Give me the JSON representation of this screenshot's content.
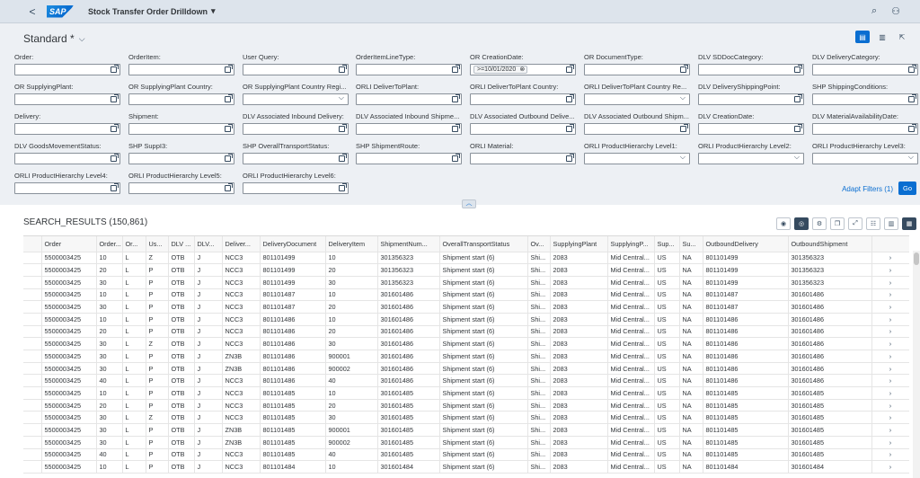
{
  "shell": {
    "back": "<",
    "logo": "SAP",
    "title": "Stock Transfer Order Drilldown",
    "title_caret": "▾"
  },
  "variant": {
    "name": "Standard *",
    "chev": "⌵"
  },
  "filters": [
    {
      "label": "Order:",
      "kind": "vh"
    },
    {
      "label": "OrderItem:",
      "kind": "vh"
    },
    {
      "label": "User Query:",
      "kind": "vh"
    },
    {
      "label": "OrderItemLineType:",
      "kind": "vh"
    },
    {
      "label": "OR CreationDate:",
      "kind": "vh",
      "token": ">=10/01/2020"
    },
    {
      "label": "OR DocumentType:",
      "kind": "vh"
    },
    {
      "label": "DLV SDDocCategory:",
      "kind": "vh"
    },
    {
      "label": "DLV DeliveryCategory:",
      "kind": "vh"
    },
    {
      "label": "OR SupplyingPlant:",
      "kind": "vh"
    },
    {
      "label": "OR SupplyingPlant Country:",
      "kind": "vh"
    },
    {
      "label": "OR SupplyingPlant Country Regi...",
      "kind": "dd"
    },
    {
      "label": "ORLI DeliverToPlant:",
      "kind": "vh"
    },
    {
      "label": "ORLI DeliverToPlant Country:",
      "kind": "vh"
    },
    {
      "label": "ORLI DeliverToPlant Country Re...",
      "kind": "dd"
    },
    {
      "label": "DLV DeliveryShippingPoint:",
      "kind": "vh"
    },
    {
      "label": "SHP ShippingConditions:",
      "kind": "vh"
    },
    {
      "label": "Delivery:",
      "kind": "vh"
    },
    {
      "label": "Shipment:",
      "kind": "vh"
    },
    {
      "label": "DLV Associated Inbound Delivery:",
      "kind": "vh"
    },
    {
      "label": "DLV Associated Inbound Shipme...",
      "kind": "vh"
    },
    {
      "label": "DLV Associated Outbound Delive...",
      "kind": "vh"
    },
    {
      "label": "DLV Associated Outbound Shipm...",
      "kind": "vh"
    },
    {
      "label": "DLV CreationDate:",
      "kind": "vh"
    },
    {
      "label": "DLV MaterialAvailabilityDate:",
      "kind": "vh"
    },
    {
      "label": "DLV GoodsMovementStatus:",
      "kind": "vh"
    },
    {
      "label": "SHP SuppI3:",
      "kind": "vh"
    },
    {
      "label": "SHP OverallTransportStatus:",
      "kind": "vh"
    },
    {
      "label": "SHP ShipmentRoute:",
      "kind": "vh"
    },
    {
      "label": "ORLI Material:",
      "kind": "vh"
    },
    {
      "label": "ORLI ProductHierarchy Level1:",
      "kind": "dd"
    },
    {
      "label": "ORLI ProductHierarchy Level2:",
      "kind": "dd"
    },
    {
      "label": "ORLI ProductHierarchy Level3:",
      "kind": "dd"
    },
    {
      "label": "ORLI ProductHierarchy Level4:",
      "kind": "vh"
    },
    {
      "label": "ORLI ProductHierarchy Level5:",
      "kind": "vh"
    },
    {
      "label": "ORLI ProductHierarchy Level6:",
      "kind": "vh"
    }
  ],
  "filterbar": {
    "adapt": "Adapt Filters (1)",
    "go": "Go",
    "collapse": "︿"
  },
  "results": {
    "title": "SEARCH_RESULTS (150,861)",
    "columns": [
      "Order",
      "Order...",
      "Or...",
      "Us...",
      "DLV ...",
      "DLV...",
      "Deliver...",
      "DeliveryDocument",
      "DeliveryItem",
      "ShipmentNum...",
      "OverallTransportStatus",
      "Ov...",
      "SupplyingPlant",
      "SupplyingP...",
      "Sup...",
      "Su...",
      "OutboundDelivery",
      "OutboundShipment"
    ],
    "rows": [
      [
        "5500003425",
        "10",
        "L",
        "Z",
        "OTB",
        "J",
        "NCC3",
        "801101499",
        "10",
        "301356323",
        "Shipment start (6)",
        "Shi...",
        "2083",
        "Mid Central...",
        "US",
        "NA",
        "801101499",
        "301356323"
      ],
      [
        "5500003425",
        "20",
        "L",
        "P",
        "OTB",
        "J",
        "NCC3",
        "801101499",
        "20",
        "301356323",
        "Shipment start (6)",
        "Shi...",
        "2083",
        "Mid Central...",
        "US",
        "NA",
        "801101499",
        "301356323"
      ],
      [
        "5500003425",
        "30",
        "L",
        "P",
        "OTB",
        "J",
        "NCC3",
        "801101499",
        "30",
        "301356323",
        "Shipment start (6)",
        "Shi...",
        "2083",
        "Mid Central...",
        "US",
        "NA",
        "801101499",
        "301356323"
      ],
      [
        "5500003425",
        "10",
        "L",
        "P",
        "OTB",
        "J",
        "NCC3",
        "801101487",
        "10",
        "301601486",
        "Shipment start (6)",
        "Shi...",
        "2083",
        "Mid Central...",
        "US",
        "NA",
        "801101487",
        "301601486"
      ],
      [
        "5500003425",
        "30",
        "L",
        "P",
        "OTB",
        "J",
        "NCC3",
        "801101487",
        "20",
        "301601486",
        "Shipment start (6)",
        "Shi...",
        "2083",
        "Mid Central...",
        "US",
        "NA",
        "801101487",
        "301601486"
      ],
      [
        "5500003425",
        "10",
        "L",
        "P",
        "OTB",
        "J",
        "NCC3",
        "801101486",
        "10",
        "301601486",
        "Shipment start (6)",
        "Shi...",
        "2083",
        "Mid Central...",
        "US",
        "NA",
        "801101486",
        "301601486"
      ],
      [
        "5500003425",
        "20",
        "L",
        "P",
        "OTB",
        "J",
        "NCC3",
        "801101486",
        "20",
        "301601486",
        "Shipment start (6)",
        "Shi...",
        "2083",
        "Mid Central...",
        "US",
        "NA",
        "801101486",
        "301601486"
      ],
      [
        "5500003425",
        "30",
        "L",
        "Z",
        "OTB",
        "J",
        "NCC3",
        "801101486",
        "30",
        "301601486",
        "Shipment start (6)",
        "Shi...",
        "2083",
        "Mid Central...",
        "US",
        "NA",
        "801101486",
        "301601486"
      ],
      [
        "5500003425",
        "30",
        "L",
        "P",
        "OTB",
        "J",
        "ZN3B",
        "801101486",
        "900001",
        "301601486",
        "Shipment start (6)",
        "Shi...",
        "2083",
        "Mid Central...",
        "US",
        "NA",
        "801101486",
        "301601486"
      ],
      [
        "5500003425",
        "30",
        "L",
        "P",
        "OTB",
        "J",
        "ZN3B",
        "801101486",
        "900002",
        "301601486",
        "Shipment start (6)",
        "Shi...",
        "2083",
        "Mid Central...",
        "US",
        "NA",
        "801101486",
        "301601486"
      ],
      [
        "5500003425",
        "40",
        "L",
        "P",
        "OTB",
        "J",
        "NCC3",
        "801101486",
        "40",
        "301601486",
        "Shipment start (6)",
        "Shi...",
        "2083",
        "Mid Central...",
        "US",
        "NA",
        "801101486",
        "301601486"
      ],
      [
        "5500003425",
        "10",
        "L",
        "P",
        "OTB",
        "J",
        "NCC3",
        "801101485",
        "10",
        "301601485",
        "Shipment start (6)",
        "Shi...",
        "2083",
        "Mid Central...",
        "US",
        "NA",
        "801101485",
        "301601485"
      ],
      [
        "5500003425",
        "20",
        "L",
        "P",
        "OTB",
        "J",
        "NCC3",
        "801101485",
        "20",
        "301601485",
        "Shipment start (6)",
        "Shi...",
        "2083",
        "Mid Central...",
        "US",
        "NA",
        "801101485",
        "301601485"
      ],
      [
        "5500003425",
        "30",
        "L",
        "Z",
        "OTB",
        "J",
        "NCC3",
        "801101485",
        "30",
        "301601485",
        "Shipment start (6)",
        "Shi...",
        "2083",
        "Mid Central...",
        "US",
        "NA",
        "801101485",
        "301601485"
      ],
      [
        "5500003425",
        "30",
        "L",
        "P",
        "OTB",
        "J",
        "ZN3B",
        "801101485",
        "900001",
        "301601485",
        "Shipment start (6)",
        "Shi...",
        "2083",
        "Mid Central...",
        "US",
        "NA",
        "801101485",
        "301601485"
      ],
      [
        "5500003425",
        "30",
        "L",
        "P",
        "OTB",
        "J",
        "ZN3B",
        "801101485",
        "900002",
        "301601485",
        "Shipment start (6)",
        "Shi...",
        "2083",
        "Mid Central...",
        "US",
        "NA",
        "801101485",
        "301601485"
      ],
      [
        "5500003425",
        "40",
        "L",
        "P",
        "OTB",
        "J",
        "NCC3",
        "801101485",
        "40",
        "301601485",
        "Shipment start (6)",
        "Shi...",
        "2083",
        "Mid Central...",
        "US",
        "NA",
        "801101485",
        "301601485"
      ],
      [
        "5500003425",
        "10",
        "L",
        "P",
        "OTB",
        "J",
        "NCC3",
        "801101484",
        "10",
        "301601484",
        "Shipment start (6)",
        "Shi...",
        "2083",
        "Mid Central...",
        "US",
        "NA",
        "801101484",
        "301601484"
      ]
    ],
    "nav_glyph": "›"
  },
  "colors": {
    "accent": "#0a6ed1",
    "shell_bg": "#dde4ec",
    "filterbar_bg": "#edf0f4"
  }
}
